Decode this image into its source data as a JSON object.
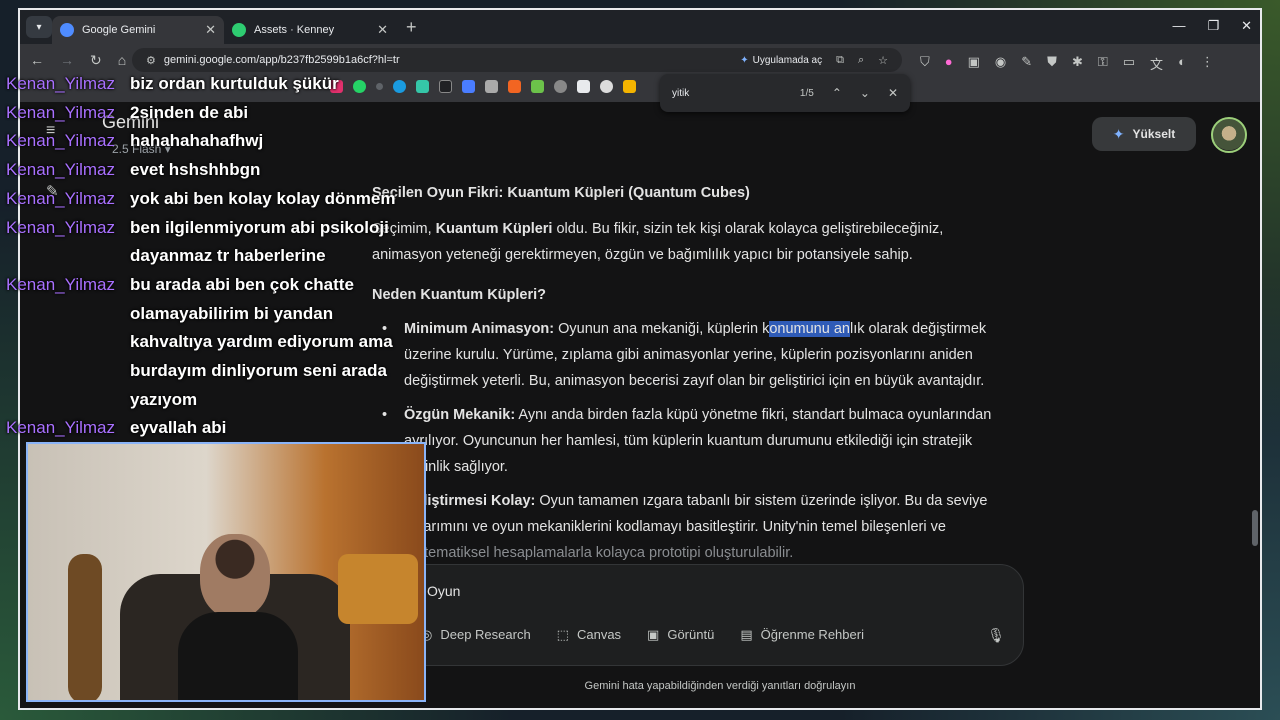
{
  "browser": {
    "tabs": [
      {
        "title": "Google Gemini",
        "color": "#4f8cff"
      },
      {
        "title": "Assets · Kenney",
        "color": "#2ecc71"
      }
    ],
    "url": "gemini.google.com/app/b237fb2599b1a6cf?hl=tr",
    "open_in_app": "Uygulamada aç"
  },
  "find": {
    "query": "yitik",
    "count": "1/5"
  },
  "app": {
    "title": "Gemini",
    "model": "2.5 Flash",
    "upgrade_label": "Yükselt"
  },
  "response": {
    "heading": "Seçilen Oyun Fikri: Kuantum Küpleri (Quantum Cubes)",
    "intro_prefix": "Seçimim, ",
    "intro_bold": "Kuantum Küpleri",
    "intro_suffix": " oldu. Bu fikir, sizin tek kişi olarak kolayca geliştirebileceğiniz, animasyon yeteneği gerektirmeyen, özgün ve bağımlılık yapıcı bir potansiyele sahip.",
    "why_heading": "Neden Kuantum Küpleri?",
    "bullets": [
      {
        "bold": "Minimum Animasyon:",
        "pre": " Oyunun ana mekaniği, küplerin k",
        "highlight": "onumunu an",
        "post": "lık olarak değiştirmek üzerine kurulu. Yürüme, zıplama gibi animasyonlar yerine, küplerin pozisyonlarını aniden değiştirmek yeterli. Bu, animasyon becerisi zayıf olan bir geliştirici için en büyük avantajdır."
      },
      {
        "bold": "Özgün Mekanik:",
        "pre": " Aynı anda birden fazla küpü yönetme fikri, standart bulmaca oyunlarından ayrılıyor. Oyuncunun her hamlesi, tüm küplerin kuantum durumunu etkilediği için stratejik derinlik sağlıyor.",
        "highlight": "",
        "post": ""
      },
      {
        "bold": "Geliştirmesi Kolay:",
        "pre": " Oyun tamamen ızgara tabanlı bir sistem üzerinde işliyor. Bu da seviye tasarımını ve oyun mekaniklerini kodlamayı basitleştirir. Unity'nin temel bileşenleri ve ",
        "highlight": "",
        "post": "matematiksel hesaplamalarla kolayca prototipi oluşturulabilir."
      }
    ]
  },
  "composer": {
    "input_text": "Oyun",
    "tools": [
      {
        "label": "Deep Research",
        "icon": "research-icon"
      },
      {
        "label": "Canvas",
        "icon": "canvas-icon"
      },
      {
        "label": "Görüntü",
        "icon": "image-icon"
      },
      {
        "label": "Öğrenme Rehberi",
        "icon": "book-icon"
      }
    ],
    "disclaimer": "Gemini hata yapabildiğinden verdiği yanıtları doğrulayın"
  },
  "chat": [
    {
      "user": "Kenan_Yilmaz",
      "text": "biz ordan kurtulduk şükür"
    },
    {
      "user": "Kenan_Yilmaz",
      "text": "2sinden de abi"
    },
    {
      "user": "Kenan_Yilmaz",
      "text": "hahahahahafhwj"
    },
    {
      "user": "Kenan_Yilmaz",
      "text": "evet hshshhbgn"
    },
    {
      "user": "Kenan_Yilmaz",
      "text": "yok abi ben kolay kolay dönmem"
    },
    {
      "user": "Kenan_Yilmaz",
      "text": "ben ilgilenmiyorum abi psikoloji dayanmaz tr haberlerine"
    },
    {
      "user": "Kenan_Yilmaz",
      "text": "bu arada abi ben çok chatte olamayabilirim bi yandan kahvaltıya yardım ediyorum ama burdayım dinliyorum seni arada yazıyom"
    },
    {
      "user": "Kenan_Yilmaz",
      "text": "eyvallah abi"
    }
  ]
}
